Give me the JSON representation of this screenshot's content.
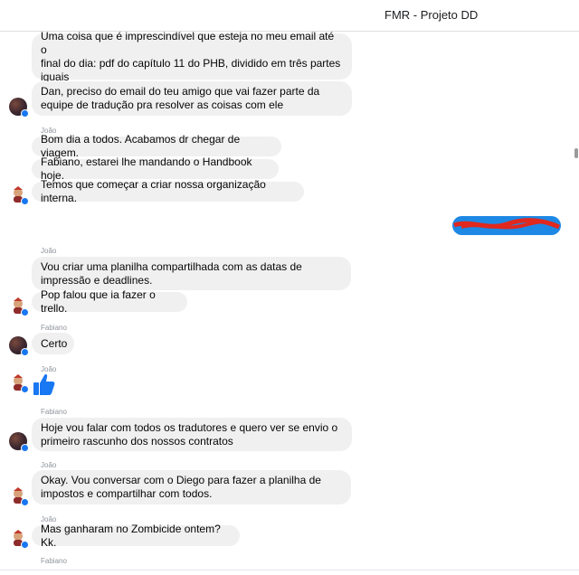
{
  "header": {
    "title": "FMR - Projeto DD"
  },
  "colors": {
    "bubble_in": "#f1f0f0",
    "bubble_out": "#1e88e5",
    "accent": "#1877f2",
    "scribble": "#e0281e"
  },
  "messages": [
    {
      "text": "Uma coisa que é imprescindível que esteja no meu email até o\nfinal do dia: pdf do capítulo 11 do PHB, dividido em três partes\niguais"
    },
    {
      "text": "Dan, preciso do email do teu amigo que vai fazer parte da\nequipe de tradução pra resolver as coisas com ele"
    },
    {
      "sender": "João"
    },
    {
      "text": "Bom dia a todos. Acabamos dr chegar de viagem."
    },
    {
      "text": "Fabiano, estarei lhe mandando o Handbook hoje."
    },
    {
      "text": "Temos que começar a criar nossa organização interna."
    },
    {
      "sender": "João"
    },
    {
      "text": "Vou criar uma planilha compartilhada com as datas de\nimpressão e deadlines."
    },
    {
      "text": "Pop falou que ia fazer o trello."
    },
    {
      "sender": "Fabiano"
    },
    {
      "text": "Certo"
    },
    {
      "sender": "João"
    },
    {
      "sender": "Fabiano"
    },
    {
      "text": "Hoje vou falar com todos os tradutores e quero ver se envio o\nprimeiro rascunho dos nossos contratos"
    },
    {
      "sender": "João"
    },
    {
      "text": "Okay. Vou conversar com o Diego para fazer a planilha de\nimpostos e compartilhar com todos."
    },
    {
      "sender": "João"
    },
    {
      "text": "Mas ganharam no Zombicide ontem? Kk."
    },
    {
      "sender": "Fabiano"
    }
  ],
  "reaction": {
    "icon": "thumbs-up-icon"
  },
  "outgoing": {
    "redacted": true
  }
}
